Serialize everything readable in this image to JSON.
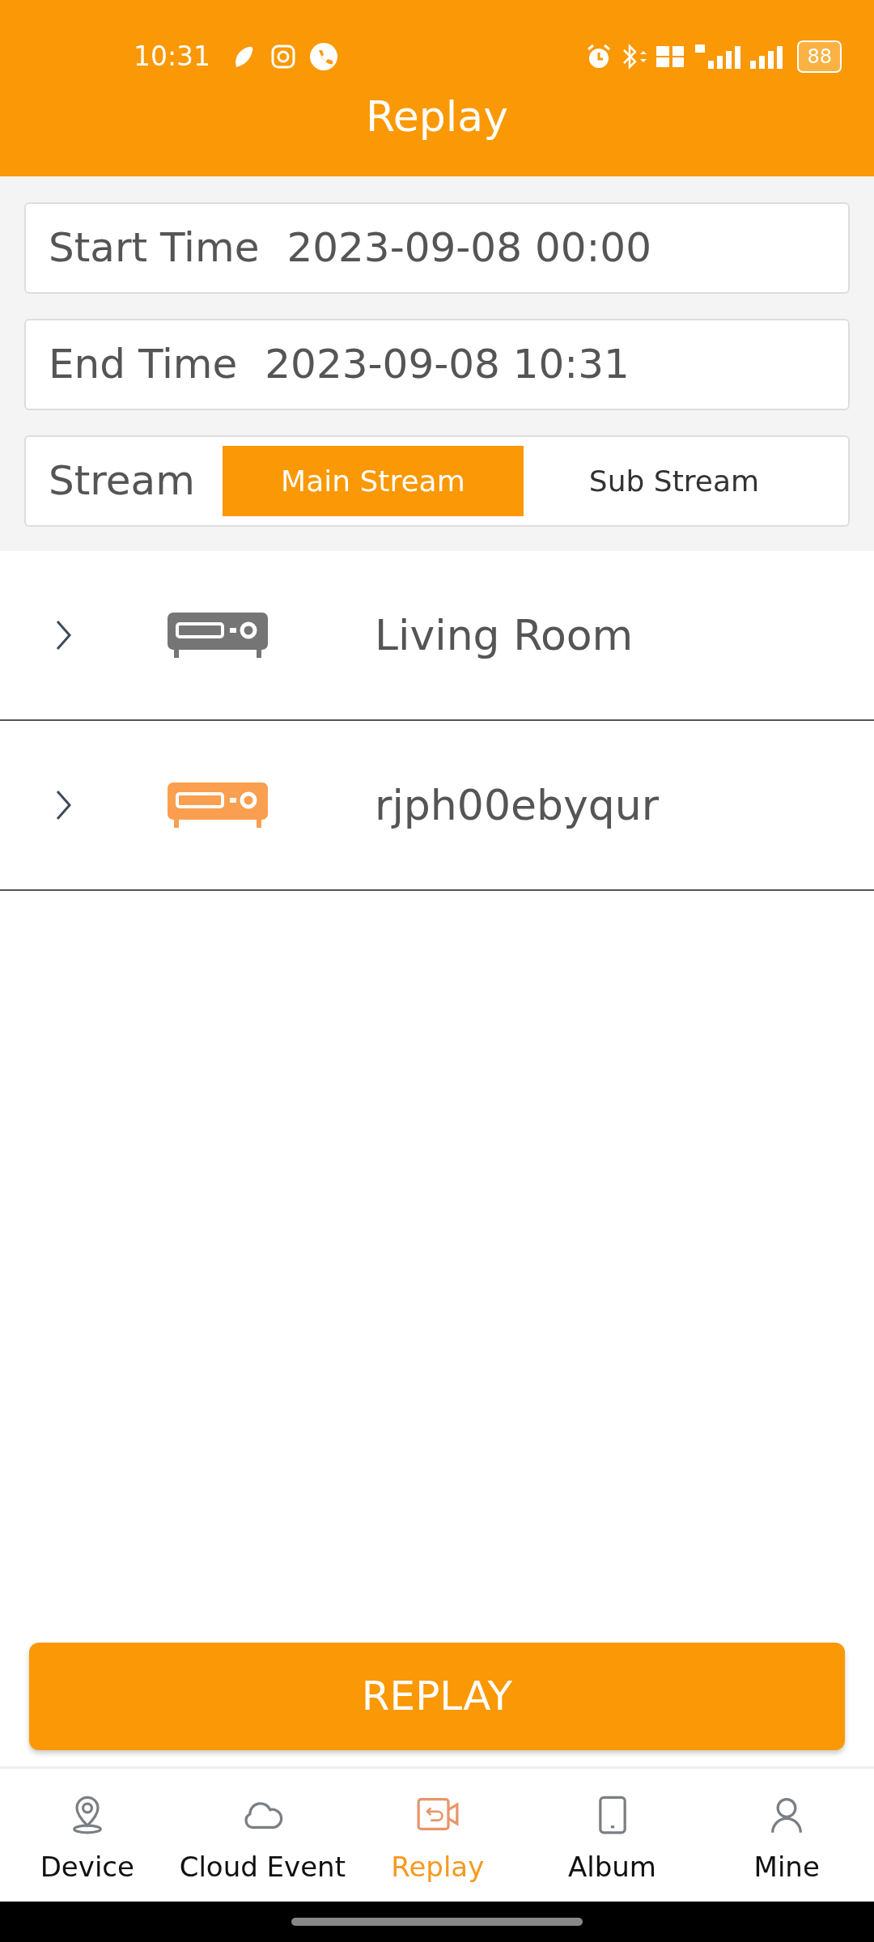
{
  "status_bar": {
    "time": "10:31",
    "battery": "88"
  },
  "header": {
    "title": "Replay"
  },
  "filters": {
    "start_label": "Start Time",
    "start_value": "2023-09-08 00:00",
    "end_label": "End Time",
    "end_value": "2023-09-08 10:31",
    "stream_label": "Stream",
    "stream_options": [
      {
        "label": "Main Stream",
        "selected": true
      },
      {
        "label": "Sub Stream",
        "selected": false
      }
    ]
  },
  "devices": [
    {
      "name": "Living Room",
      "color": "#757575"
    },
    {
      "name": "rjph00ebyqur",
      "color": "#f99f4f"
    }
  ],
  "replay_button": "REPLAY",
  "nav": [
    {
      "label": "Device",
      "kind": "pin",
      "selected": false
    },
    {
      "label": "Cloud Event",
      "kind": "cloud",
      "selected": false
    },
    {
      "label": "Replay",
      "kind": "replay",
      "selected": true
    },
    {
      "label": "Album",
      "kind": "tablet",
      "selected": false
    },
    {
      "label": "Mine",
      "kind": "person",
      "selected": false
    }
  ]
}
